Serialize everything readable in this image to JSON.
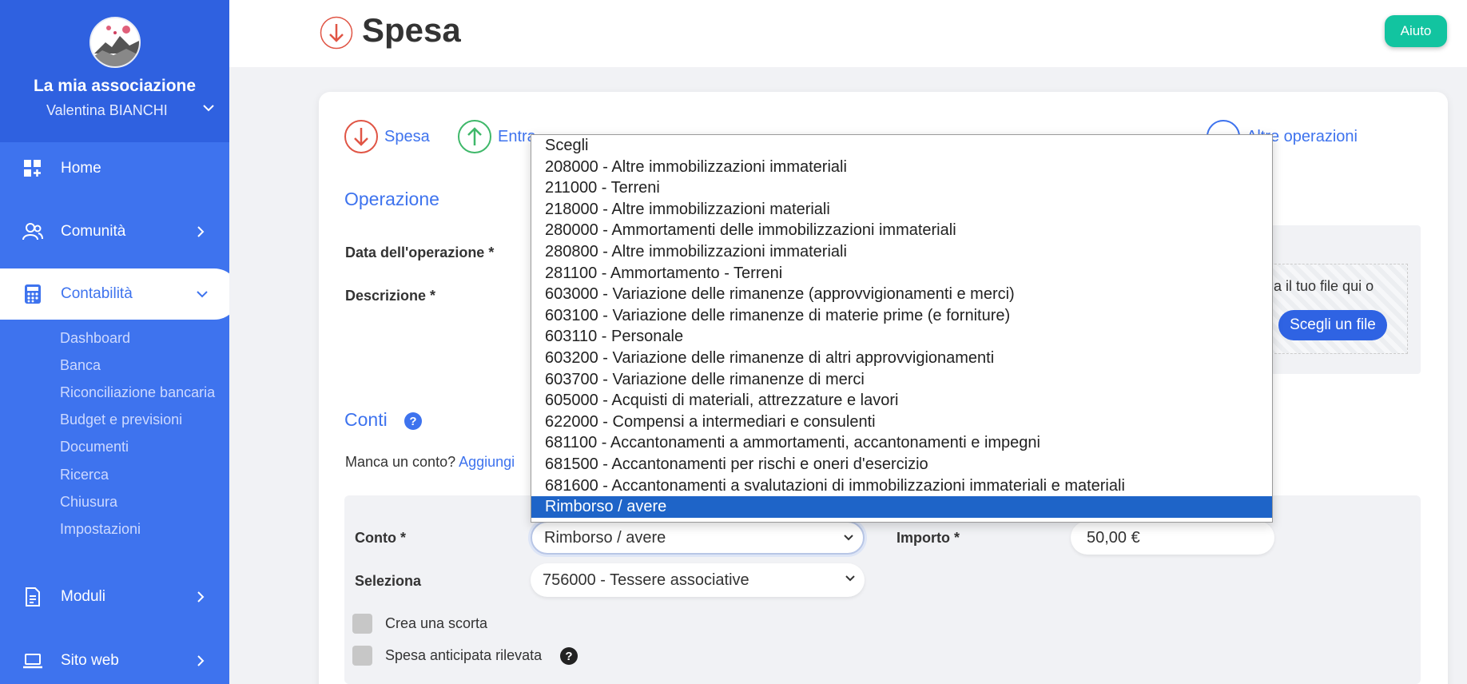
{
  "header": {
    "title": "Spesa",
    "help_label": "Aiuto"
  },
  "sidebar": {
    "org_name": "La mia associazione",
    "user_name": "Valentina BIANCHI",
    "nav": {
      "home": "Home",
      "comunita": "Comunità",
      "contabilita": "Contabilità",
      "moduli": "Moduli",
      "sito_web": "Sito web"
    },
    "sub_items": [
      "Dashboard",
      "Banca",
      "Riconciliazione bancaria",
      "Budget e previsioni",
      "Documenti",
      "Ricerca",
      "Chiusura",
      "Impostazioni"
    ]
  },
  "op_tabs": {
    "spesa": "Spesa",
    "entrata": "Entra",
    "altre": "Altre operazioni"
  },
  "form": {
    "section_operazione": "Operazione",
    "data_label": "Data dell'operazione *",
    "descrizione_label": "Descrizione *",
    "upload_text": "scina il tuo file qui o",
    "choose_file": "Scegli un file",
    "section_conti": "Conti",
    "missing_prefix": "Manca un conto?",
    "missing_link": "Aggiungi",
    "conto_label": "Conto *",
    "conto_value": "Rimborso / avere",
    "importo_label": "Importo *",
    "importo_value": "50,00 €",
    "seleziona_label": "Seleziona",
    "seleziona_value": "756000 - Tessere associative",
    "cb_scorta": "Crea una scorta",
    "cb_anticipata": "Spesa anticipata rilevata"
  },
  "dropdown": {
    "options": [
      "Scegli",
      "208000 - Altre immobilizzazioni immateriali",
      "211000 - Terreni",
      "218000 - Altre immobilizzazioni materiali",
      "280000 - Ammortamenti delle immobilizzazioni immateriali",
      "280800 - Altre immobilizzazioni immateriali",
      "281100 - Ammortamento - Terreni",
      "603000 - Variazione delle rimanenze (approvvigionamenti e merci)",
      "603100 - Variazione delle rimanenze di materie prime (e forniture)",
      "603110 - Personale",
      "603200 - Variazione delle rimanenze di altri approvvigionamenti",
      "603700 - Variazione delle rimanenze di merci",
      "605000 - Acquisti di materiali, attrezzature e lavori",
      "622000 - Compensi a intermediari e consulenti",
      "681100 - Accantonamenti a ammortamenti, accantonamenti e impegni",
      "681500 - Accantonamenti per rischi e oneri d'esercizio",
      "681600 - Accantonamenti a svalutazioni di immobilizzazioni immateriali e materiali",
      "Rimborso / avere"
    ],
    "selected_index": 17
  },
  "colors": {
    "accent": "#3e73ee",
    "help": "#12c4a0",
    "spesa": "#e05545",
    "entrata": "#3fb86a"
  }
}
